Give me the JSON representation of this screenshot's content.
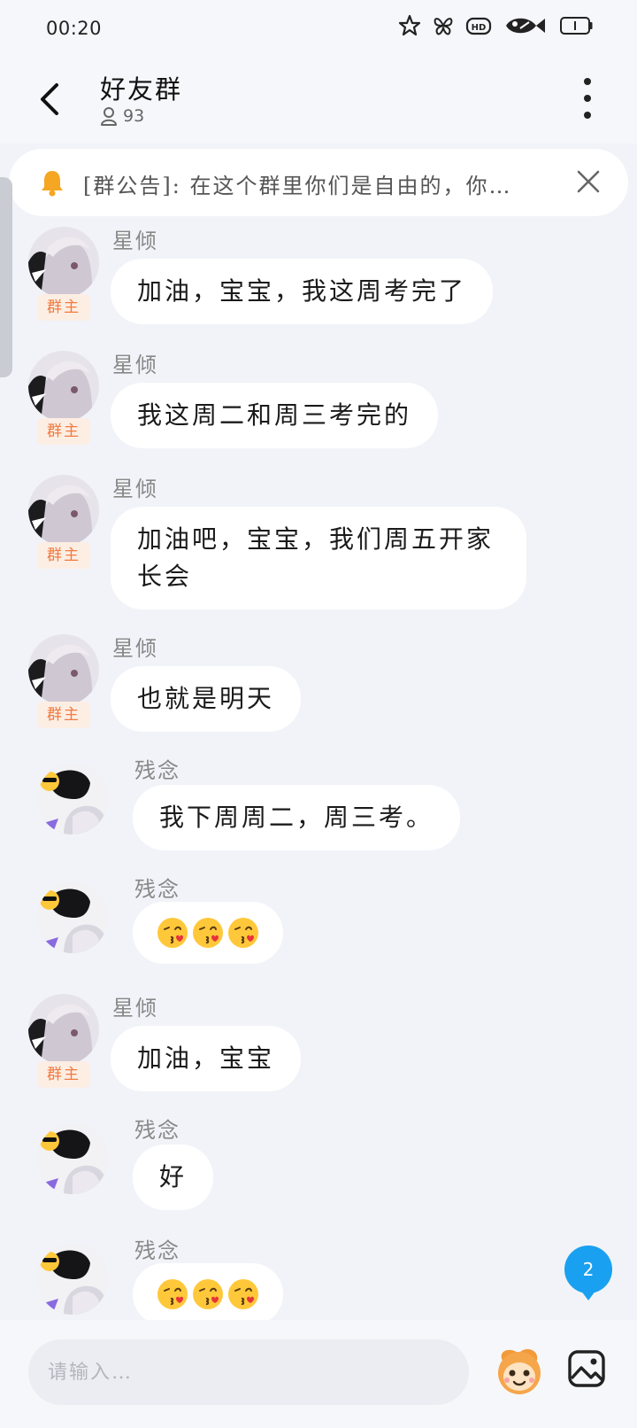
{
  "status_bar": {
    "time": "00:20",
    "icons": [
      "star-icon",
      "butterfly-icon",
      "hd-icon",
      "fish-icon",
      "battery-icon"
    ]
  },
  "header": {
    "title": "好友群",
    "member_count": "93"
  },
  "notice": {
    "text": "[群公告]: 在这个群里你们是自由的，你…"
  },
  "messages": [
    {
      "sender": "星倾",
      "badge": "群主",
      "text": "加油，宝宝，我这周考完了"
    },
    {
      "sender": "星倾",
      "badge": "群主",
      "text": "我这周二和周三考完的"
    },
    {
      "sender": "星倾",
      "badge": "群主",
      "text": "加油吧，宝宝，我们周五开家长会"
    },
    {
      "sender": "星倾",
      "badge": "群主",
      "text": "也就是明天"
    },
    {
      "sender": "残念",
      "text": "我下周周二，周三考。"
    },
    {
      "sender": "残念",
      "emoji": [
        "😘",
        "😘",
        "😘"
      ]
    },
    {
      "sender": "星倾",
      "badge": "群主",
      "text": "加油，宝宝"
    },
    {
      "sender": "残念",
      "text": "好"
    },
    {
      "sender": "残念",
      "emoji": [
        "😘",
        "😘",
        "😘"
      ]
    }
  ],
  "unread_count": "2",
  "input": {
    "placeholder": "请输入…"
  },
  "colors": {
    "background": "#f1f3f8",
    "badge_text": "#f07a3e",
    "badge_bg": "#fdeee4",
    "unread": "#1aa0f0",
    "bell": "#f5a623"
  }
}
